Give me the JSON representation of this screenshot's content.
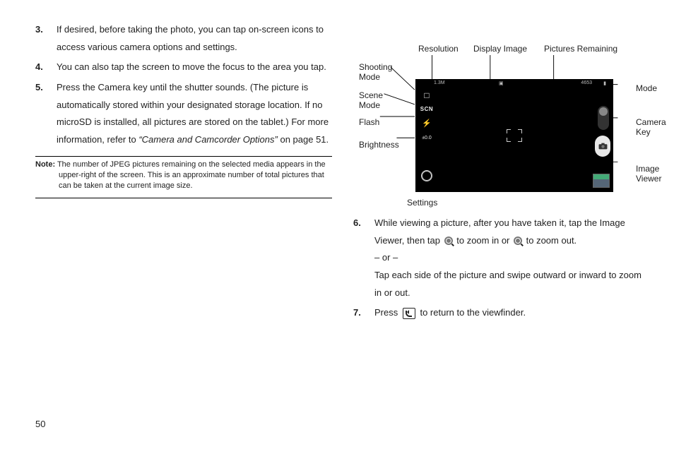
{
  "leftColumn": {
    "items": [
      {
        "num": "3.",
        "text": "If desired, before taking the photo, you can tap on-screen icons to access various camera options and settings."
      },
      {
        "num": "4.",
        "text": "You can also tap the screen to move the focus to the area you tap."
      },
      {
        "num": "5.",
        "text": "Press the Camera key until the shutter sounds. (The picture is automatically stored within your designated storage location. If no microSD is installed, all pictures are stored on the tablet.) For more information, refer to ",
        "ref": "“Camera and Camcorder Options”",
        "refTail": "  on page 51."
      }
    ],
    "note": {
      "label": "Note:",
      "text": " The number of JPEG pictures remaining on the selected media appears in the upper-right of the screen. This is an approximate number of total pictures that can be taken at the current image size."
    }
  },
  "diagram": {
    "topLabels": {
      "resolution": "Resolution",
      "displayImage": "Display Image",
      "picturesRemaining": "Pictures Remaining"
    },
    "leftLabels": {
      "shootingMode": "Shooting",
      "shootingMode2": "Mode",
      "sceneMode": "Scene",
      "sceneMode2": "Mode",
      "flash": "Flash",
      "brightness": "Brightness"
    },
    "rightLabels": {
      "mode": "Mode",
      "cameraKey": "Camera",
      "cameraKey2": "Key",
      "imageViewer": "Image",
      "imageViewer2": "Viewer"
    },
    "bottomLabel": "Settings",
    "screen": {
      "leftIcons": {
        "shoot": "□",
        "scn": "SCN",
        "flash": "⚡",
        "brightness": "±0.0"
      },
      "topbar": {
        "res": "1.3M",
        "mid": "▣",
        "remaining": "4653",
        "batt": "▮"
      }
    }
  },
  "rightList": {
    "item6": {
      "num": "6.",
      "a": "While viewing a picture, after you have taken it, tap the Image Viewer, then tap ",
      "b": " to zoom in or ",
      "c": " to zoom out.",
      "or": "– or –",
      "d": "Tap each side of the picture and swipe outward or inward to zoom in or out."
    },
    "item7": {
      "num": "7.",
      "a": "Press ",
      "b": " to return to the viewfinder."
    }
  },
  "pageNumber": "50"
}
